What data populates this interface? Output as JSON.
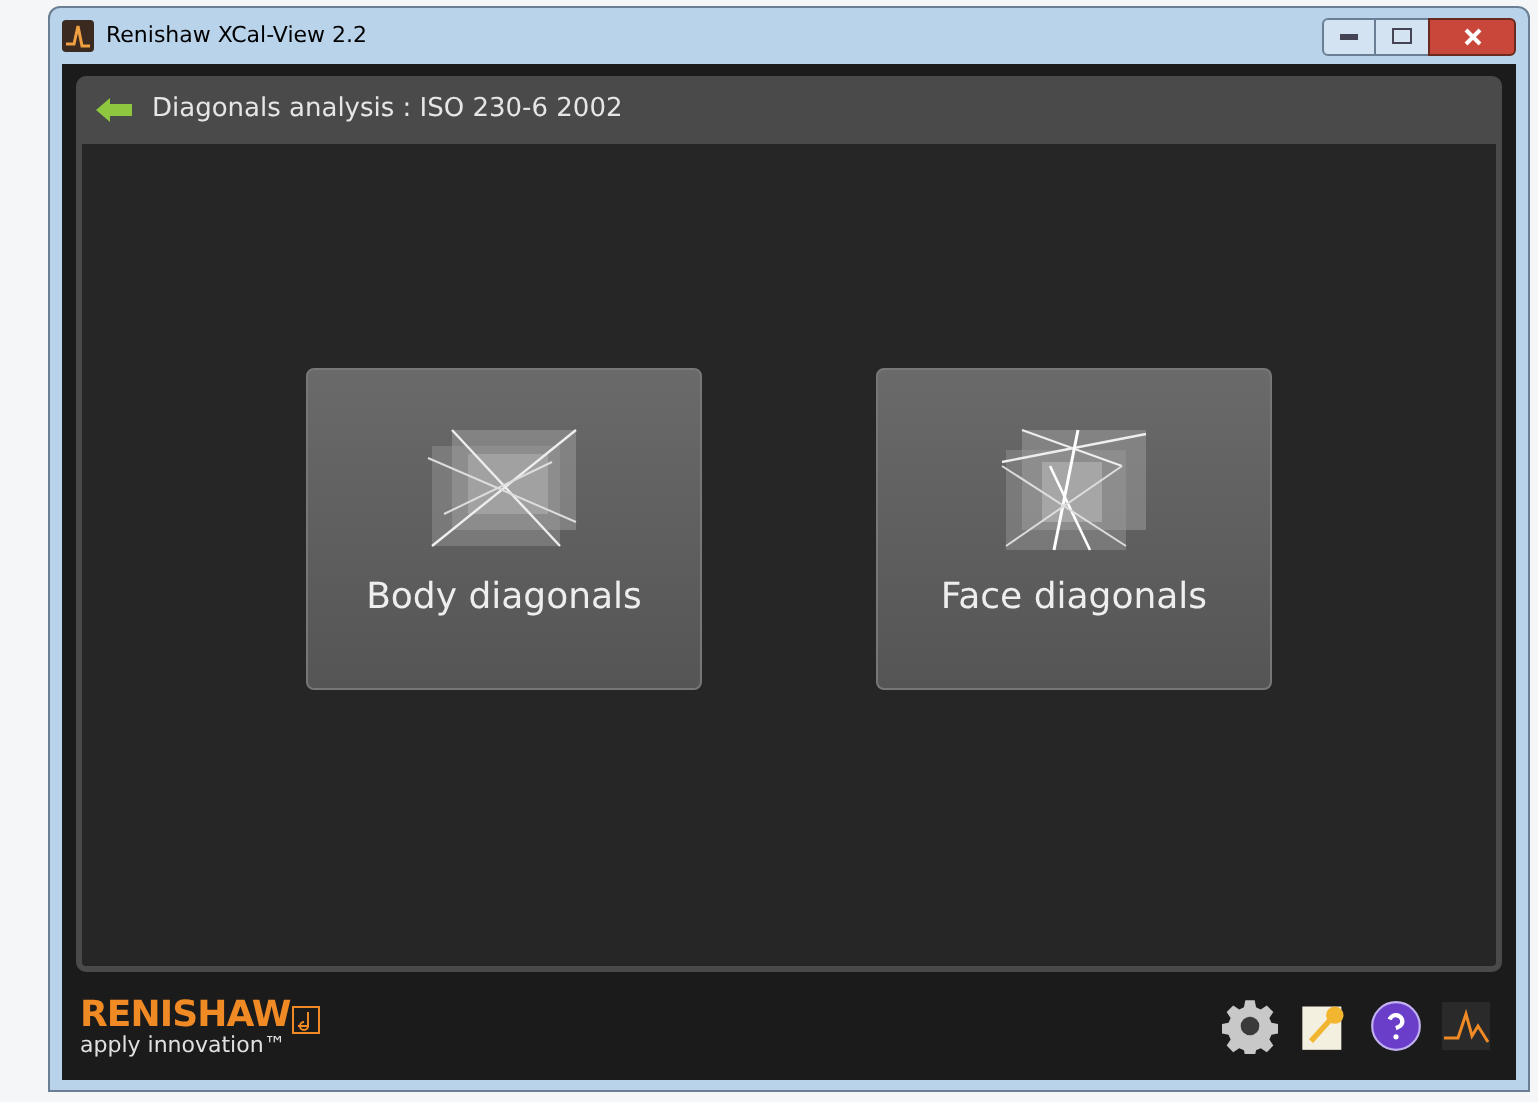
{
  "window": {
    "title": "Renishaw XCal-View 2.2"
  },
  "header": {
    "title": "Diagonals analysis : ISO 230-6 2002"
  },
  "options": [
    {
      "kind": "body",
      "label": "Body diagonals"
    },
    {
      "kind": "face",
      "label": "Face diagonals"
    }
  ],
  "footer": {
    "brand": "RENISHAW",
    "tagline": "apply innovation™"
  }
}
